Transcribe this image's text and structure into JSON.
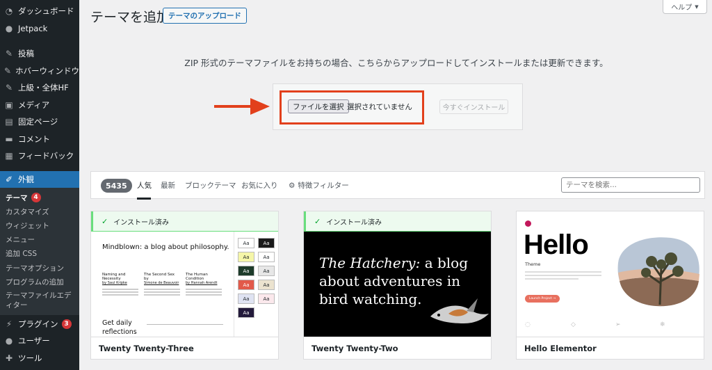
{
  "sidebar": {
    "items": [
      {
        "label": "ダッシュボード",
        "icon": "dashboard-icon"
      },
      {
        "label": "Jetpack",
        "icon": "jetpack-icon"
      },
      {
        "label": "投稿",
        "icon": "pin-icon"
      },
      {
        "label": "ホバーウィンドウ",
        "icon": "pin-icon"
      },
      {
        "label": "上級・全体HF",
        "icon": "pin-icon"
      },
      {
        "label": "メディア",
        "icon": "media-icon"
      },
      {
        "label": "固定ページ",
        "icon": "page-icon"
      },
      {
        "label": "コメント",
        "icon": "comment-icon"
      },
      {
        "label": "フィードバック",
        "icon": "feedback-icon"
      }
    ],
    "active": {
      "label": "外観",
      "icon": "appearance-icon"
    },
    "submenu": {
      "themes_label": "テーマ",
      "themes_badge": "4",
      "others": [
        "カスタマイズ",
        "ウィジェット",
        "メニュー",
        "追加 CSS",
        "テーマオプション",
        "プログラムの追加",
        "テーマファイルエディター"
      ]
    },
    "bottom": {
      "plugins_label": "プラグイン",
      "plugins_badge": "3",
      "users_label": "ユーザー",
      "tools_label": "ツール"
    }
  },
  "header": {
    "title": "テーマを追加",
    "upload_button": "テーマのアップロード",
    "help": "ヘルプ"
  },
  "upload": {
    "description": "ZIP 形式のテーマファイルをお持ちの場合、こちらからアップロードしてインストールまたは更新できます。",
    "choose_file": "ファイルを選択",
    "no_file": "選択されていません",
    "install_now": "今すぐインストール"
  },
  "filter": {
    "count": "5435",
    "tabs": [
      "人気",
      "最新",
      "ブロックテーマ",
      "お気に入り"
    ],
    "feature_filter": "特徴フィルター",
    "search_placeholder": "テーマを検索..."
  },
  "themes": [
    {
      "name": "Twenty Twenty-Three",
      "installed_label": "インストール済み",
      "preview": {
        "title": "Mindblown: a blog about philosophy.",
        "posts": [
          {
            "title": "Naming and Necessity",
            "author": "by Saul Kripke"
          },
          {
            "title": "The Second Sex by",
            "author": "Simone de Beauvoir"
          },
          {
            "title": "The Human Condition",
            "author": "by Hannah Arendt"
          }
        ],
        "get_daily": "Get daily",
        "reflections": "reflections",
        "swatch_label": "Aa"
      }
    },
    {
      "name": "Twenty Twenty-Two",
      "installed_label": "インストール済み",
      "preview": {
        "italic": "The Hatchery:",
        "rest": " a blog about adventures in bird watching."
      }
    },
    {
      "name": "Hello Elementor",
      "preview": {
        "headline": "Hello",
        "theme_label": "Theme",
        "button": "Launch Project →"
      }
    }
  ],
  "colors": {
    "sidebar_bg": "#1d2327",
    "accent": "#2271b1",
    "highlight_red": "#e2401c",
    "installed_green": "#68de7c"
  }
}
